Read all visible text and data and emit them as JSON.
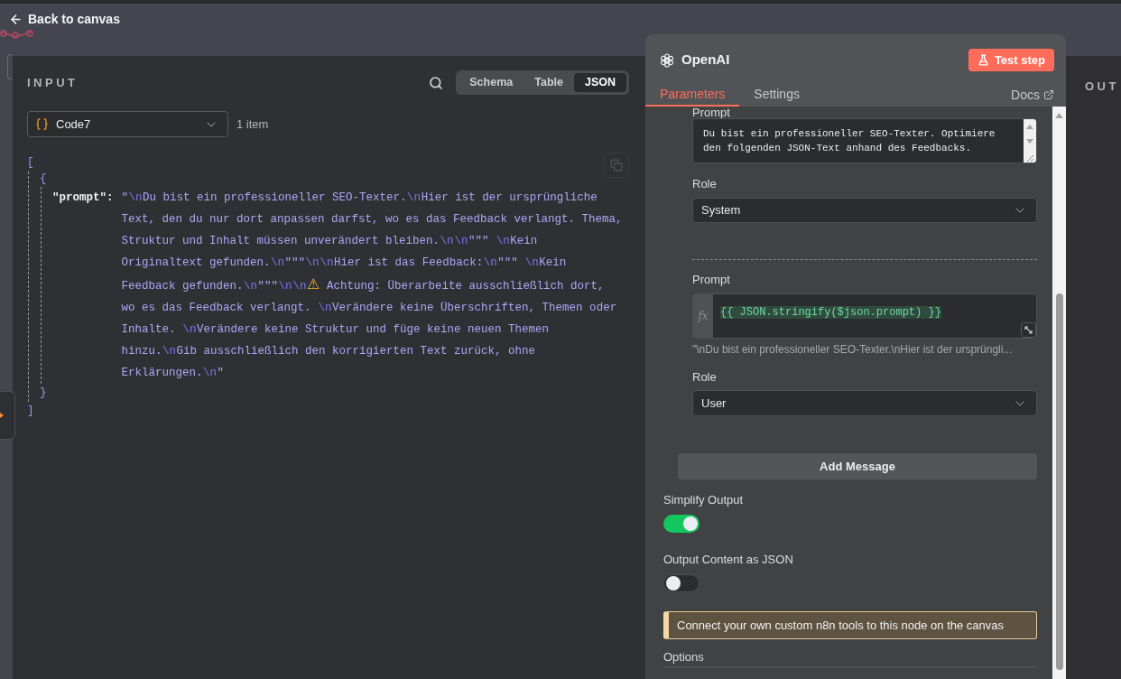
{
  "canvas": {
    "back_link": "Back to canvas"
  },
  "input_panel": {
    "title": "INPUT",
    "view_tabs": [
      {
        "label": "Schema",
        "selected": false
      },
      {
        "label": "Table",
        "selected": false
      },
      {
        "label": "JSON",
        "selected": true
      }
    ],
    "source": "Code7",
    "item_count": "1 item",
    "json_view": {
      "open": "[",
      "close": "]",
      "items": [
        {
          "open": "{",
          "close": "}",
          "fields": [
            {
              "key": "\"prompt\":",
              "value": "\"\\nDu bist ein professioneller SEO-Texter.\\nHier ist der ursprüngliche Text, den du nur dort anpassen darfst, wo es das Feedback verlangt. Thema, Struktur und Inhalt müssen unverändert bleiben.\\n\\n\"\"\" \\nKein Originaltext gefunden.\\n\"\"\"\\n\\nHier ist das Feedback:\\n\"\"\" \\nKein Feedback gefunden.\\n\"\"\"\\n\\n⚠ Achtung: Überarbeite ausschließlich dort, wo es das Feedback verlangt. \\nVerändere keine Überschriften, Themen oder Inhalte. \\nVerändere keine Struktur und füge keine neuen Themen hinzu.\\nGib ausschließlich den korrigierten Text zurück, ohne Erklärungen.\\n\""
            }
          ]
        }
      ]
    }
  },
  "node_panel": {
    "title": "OpenAI",
    "test_button": "Test step",
    "tabs": [
      {
        "label": "Parameters",
        "selected": true
      },
      {
        "label": "Settings",
        "selected": false
      }
    ],
    "docs_link": "Docs",
    "messages": [
      {
        "kind": "text",
        "prompt_label": "Prompt",
        "prompt": "Du bist ein professioneller SEO-Texter. Optimiere den folgenden JSON-Text anhand des Feedbacks.",
        "role_label": "Role",
        "role": "System"
      },
      {
        "kind": "expression",
        "prompt_label": "Prompt",
        "marker": "fx",
        "prompt": "{{ JSON.stringify($json.prompt) }}",
        "preview": "\"\\nDu bist ein professioneller SEO-Texter.\\nHier ist der ursprüngli...",
        "role_label": "Role",
        "role": "User"
      }
    ],
    "add_message_button": "Add Message",
    "toggles": [
      {
        "label": "Simplify Output",
        "on": true
      },
      {
        "label": "Output Content as JSON",
        "on": false
      }
    ],
    "notice": "Connect your own custom n8n tools to this node on the canvas",
    "options_label": "Options"
  },
  "output_panel": {
    "title": "OUT"
  }
}
